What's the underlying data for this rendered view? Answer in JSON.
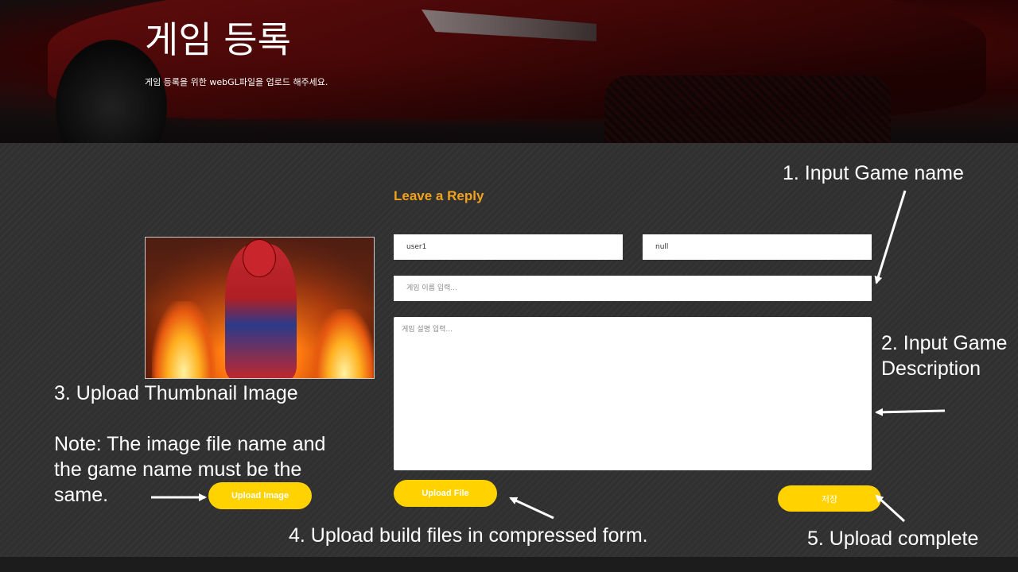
{
  "hero": {
    "title": "게임 등록",
    "subtitle": "게임 등록을 위한 webGL파일을 업로드 해주세요."
  },
  "form": {
    "section_title": "Leave a Reply",
    "user_value": "user1",
    "null_value": "null",
    "game_name_placeholder": "게임 이름 입력...",
    "description_placeholder": "게임 설명 입력..."
  },
  "buttons": {
    "upload_image": "Upload Image",
    "upload_file": "Upload File",
    "save": "저장"
  },
  "annotations": {
    "step1": "1. Input Game name",
    "step2": "2. Input Game Description",
    "step3": "3. Upload Thumbnail Image",
    "note": "Note: The image file name and the game name must be the same.",
    "step4": "4. Upload build files in compressed form.",
    "step5": "5. Upload complete"
  },
  "colors": {
    "accent": "#f2a21c",
    "button": "#ffd200",
    "background": "#2d2d2d"
  }
}
